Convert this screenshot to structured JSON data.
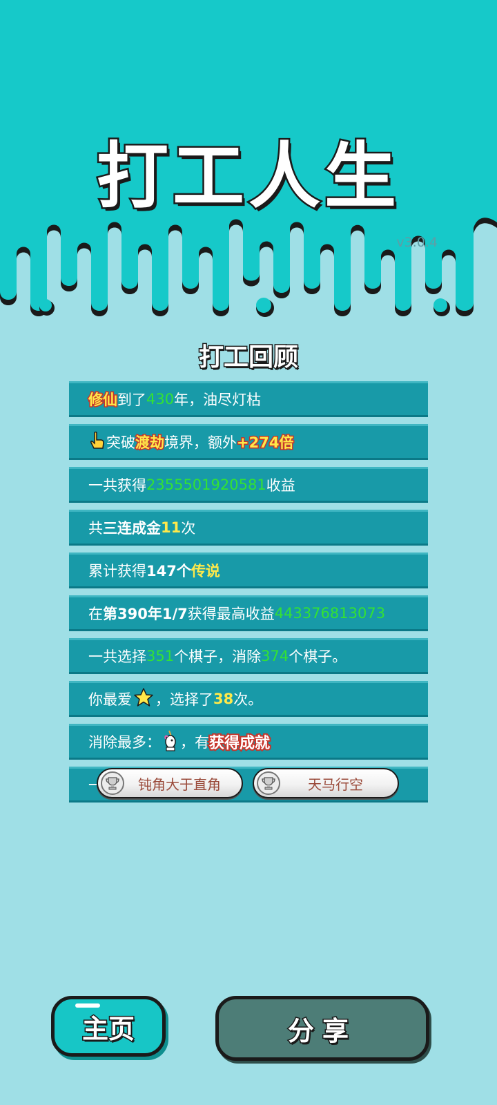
{
  "app": {
    "title": "打工人生",
    "version": "v3.0.4",
    "top_color": "#16c9c9",
    "bg_color": "#9fdfe6"
  },
  "review": {
    "title": "打工回顾",
    "rows": [
      {
        "p1": "修仙",
        "p2": "到了",
        "p3": "430",
        "p4": "年，油尽灯枯"
      },
      {
        "icon": "pointing-hand-icon",
        "p1": "突破",
        "p2": "渡劫",
        "p3": "境界，额外",
        "p4": "+274倍"
      },
      {
        "p1": "一共获得",
        "p2": "2355501920581",
        "p3": "收益"
      },
      {
        "p1": "共",
        "p2": "三连成金",
        "p3": "11",
        "p4": "次"
      },
      {
        "p1": "累计获得",
        "p2": "147个",
        "p3": "传说"
      },
      {
        "p1": "在 ",
        "p2": "第390年1/7",
        "p3": " 获得最高收益",
        "p4": "443376813073"
      },
      {
        "p1": "一共选择",
        "p2": "351",
        "p3": "个棋子，消除",
        "p4": "374",
        "p5": "个棋子。"
      },
      {
        "p1": "你最爱",
        "icon": "star-icon",
        "p2": "，选择了",
        "p3": "38",
        "p4": "次。"
      },
      {
        "p1": "消除最多：",
        "icon": "unicorn-icon",
        "p2": "，有",
        "badge": "获得成就"
      },
      {
        "p1": "一"
      }
    ]
  },
  "achievements": [
    {
      "icon": "trophy-icon",
      "label": "钝角大于直角"
    },
    {
      "icon": "trophy-icon",
      "label": "天马行空"
    }
  ],
  "buttons": {
    "home": "主页",
    "share": "分享"
  }
}
